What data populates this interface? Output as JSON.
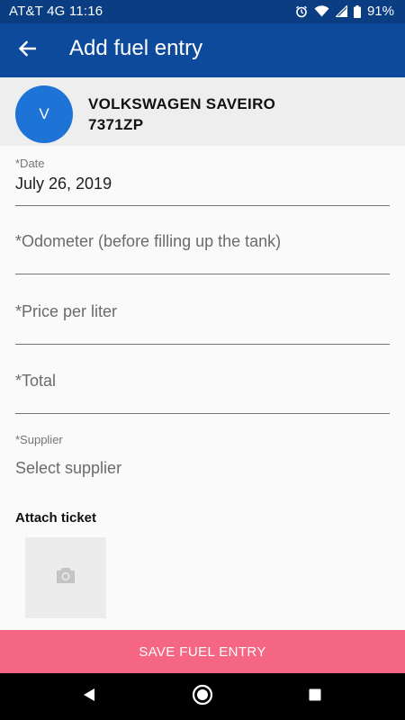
{
  "status_bar": {
    "carrier_time": "AT&T 4G 11:16",
    "battery": "91%",
    "icons": [
      "alarm-icon",
      "wifi-icon",
      "signal-icon",
      "battery-icon"
    ]
  },
  "app_bar": {
    "title": "Add fuel entry",
    "back_icon": "arrow-left-icon",
    "background": "#0d4a9c"
  },
  "vehicle": {
    "avatar_letter": "V",
    "avatar_color": "#1e74d6",
    "name": "VOLKSWAGEN SAVEIRO",
    "plate": "7371ZP"
  },
  "form": {
    "date": {
      "label": "*Date",
      "value": "July 26, 2019"
    },
    "odometer": {
      "placeholder": "*Odometer (before filling up the tank)"
    },
    "price_per_liter": {
      "placeholder": "*Price per liter"
    },
    "total": {
      "placeholder": "*Total"
    },
    "supplier": {
      "label": "*Supplier",
      "placeholder": "Select supplier"
    }
  },
  "attach": {
    "label": "Attach ticket",
    "icon": "camera-icon"
  },
  "save_button": {
    "label": "SAVE FUEL ENTRY",
    "color": "#f46683"
  },
  "nav_bar": {
    "icons": [
      "back-triangle-icon",
      "home-circle-icon",
      "recents-square-icon"
    ]
  }
}
